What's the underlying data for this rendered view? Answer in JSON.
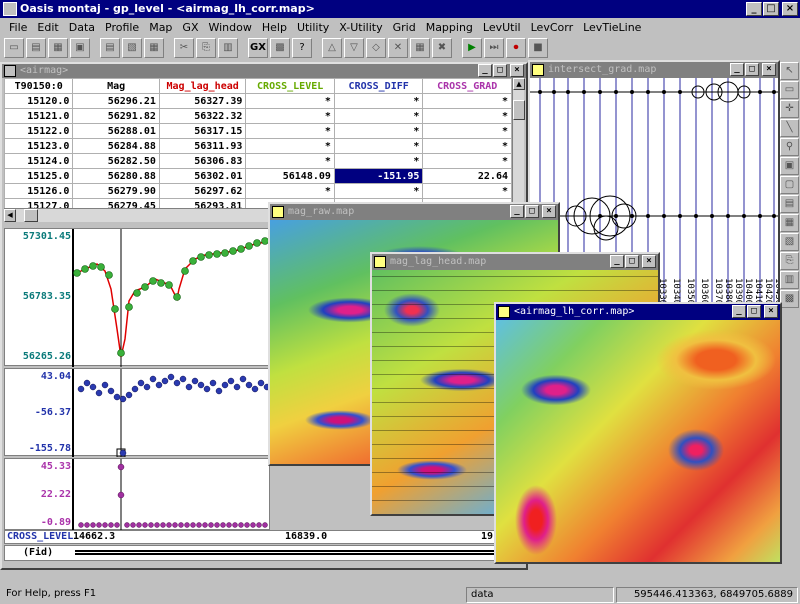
{
  "app": {
    "title": "Oasis montaj - gp_level - <airmag_lh_corr.map>"
  },
  "menu": [
    "File",
    "Edit",
    "Data",
    "Profile",
    "Map",
    "GX",
    "Window",
    "Help",
    "Utility",
    "X-Utility",
    "Grid",
    "Mapping",
    "LevUtil",
    "LevCorr",
    "LevTieLine"
  ],
  "db_window": {
    "title": "<airmag>",
    "columns": [
      "T90150:0",
      "Mag",
      "Mag_lag_head",
      "CROSS_LEVEL",
      "CROSS_DIFF",
      "CROSS_GRAD"
    ],
    "column_colors": [
      "#000000",
      "#000000",
      "#cc0000",
      "#66aa00",
      "#2233aa",
      "#aa33aa"
    ],
    "rows": [
      [
        "15120.0",
        "56296.21",
        "56327.39",
        "*",
        "*",
        "*"
      ],
      [
        "15121.0",
        "56291.82",
        "56322.32",
        "*",
        "*",
        "*"
      ],
      [
        "15122.0",
        "56288.01",
        "56317.15",
        "*",
        "*",
        "*"
      ],
      [
        "15123.0",
        "56284.88",
        "56311.93",
        "*",
        "*",
        "*"
      ],
      [
        "15124.0",
        "56282.50",
        "56306.83",
        "*",
        "*",
        "*"
      ],
      [
        "15125.0",
        "56280.88",
        "56302.01",
        "56148.09",
        "-151.95",
        "22.64"
      ],
      [
        "15126.0",
        "56279.90",
        "56297.62",
        "*",
        "*",
        "*"
      ],
      [
        "15127.0",
        "56279.45",
        "56293.81",
        "*",
        "*",
        "*"
      ]
    ]
  },
  "profiles": {
    "p1": {
      "top": "57301.45",
      "mid": "56783.35",
      "bot": "56265.26"
    },
    "p2": {
      "top": "43.04",
      "mid": "-56.37",
      "bot": "-155.78"
    },
    "p3": {
      "top": "45.33",
      "mid": "22.22",
      "bot": "-0.89"
    },
    "axis_label": "CROSS_LEVEL",
    "axis_values": [
      "14662.3",
      "16839.0",
      "19"
    ],
    "fid_label": "(Fid)"
  },
  "map_windows": {
    "intersect": {
      "title": "intersect_grad.map",
      "labels": [
        "10330",
        "10340",
        "10350",
        "10360",
        "10370",
        "10380",
        "10390",
        "10400",
        "10410",
        "10420",
        "10430"
      ]
    },
    "raw": {
      "title": "mag_raw.map"
    },
    "lag": {
      "title": "mag_lag_head.map"
    },
    "corr": {
      "title": "<airmag_lh_corr.map>"
    }
  },
  "status": {
    "help": "For Help, press F1",
    "field": "data",
    "coords": "595446.413363, 6849705.6889"
  }
}
